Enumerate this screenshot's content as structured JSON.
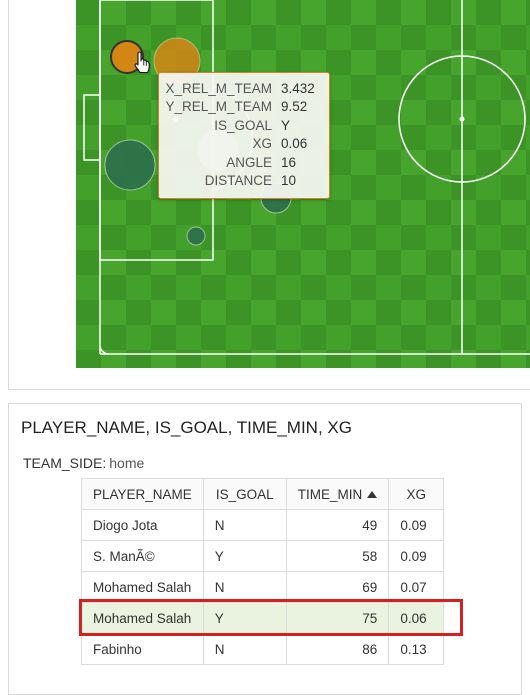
{
  "tooltip": {
    "rows": [
      {
        "key": "X_REL_M_TEAM",
        "value": "3.432"
      },
      {
        "key": "Y_REL_M_TEAM",
        "value": "9.52"
      },
      {
        "key": "IS_GOAL",
        "value": "Y"
      },
      {
        "key": "XG",
        "value": "0.06"
      },
      {
        "key": "ANGLE",
        "value": "16"
      },
      {
        "key": "DISTANCE",
        "value": "10"
      }
    ]
  },
  "pitch": {
    "colors": {
      "grass_light": "#43a02a",
      "grass_dark": "#3a9224",
      "lines": "#ffffff",
      "goal_bubble": "#d38616",
      "miss_bubble": "#2e6e4c"
    }
  },
  "table_panel": {
    "title": "PLAYER_NAME, IS_GOAL, TIME_MIN, XG",
    "filter_label": "TEAM_SIDE:",
    "filter_value": "home",
    "columns": [
      "PLAYER_NAME",
      "IS_GOAL",
      "TIME_MIN",
      "XG"
    ],
    "sort": {
      "column": "TIME_MIN",
      "direction": "ascending"
    },
    "rows": [
      {
        "player": "Diogo Jota",
        "goal": "N",
        "time": "49",
        "xg": "0.09",
        "selected": false
      },
      {
        "player": "S. ManÃ©",
        "goal": "Y",
        "time": "58",
        "xg": "0.09",
        "selected": false
      },
      {
        "player": "Mohamed Salah",
        "goal": "N",
        "time": "69",
        "xg": "0.07",
        "selected": false
      },
      {
        "player": "Mohamed Salah",
        "goal": "Y",
        "time": "75",
        "xg": "0.06",
        "selected": true
      },
      {
        "player": "Fabinho",
        "goal": "N",
        "time": "86",
        "xg": "0.13",
        "selected": false
      }
    ]
  }
}
